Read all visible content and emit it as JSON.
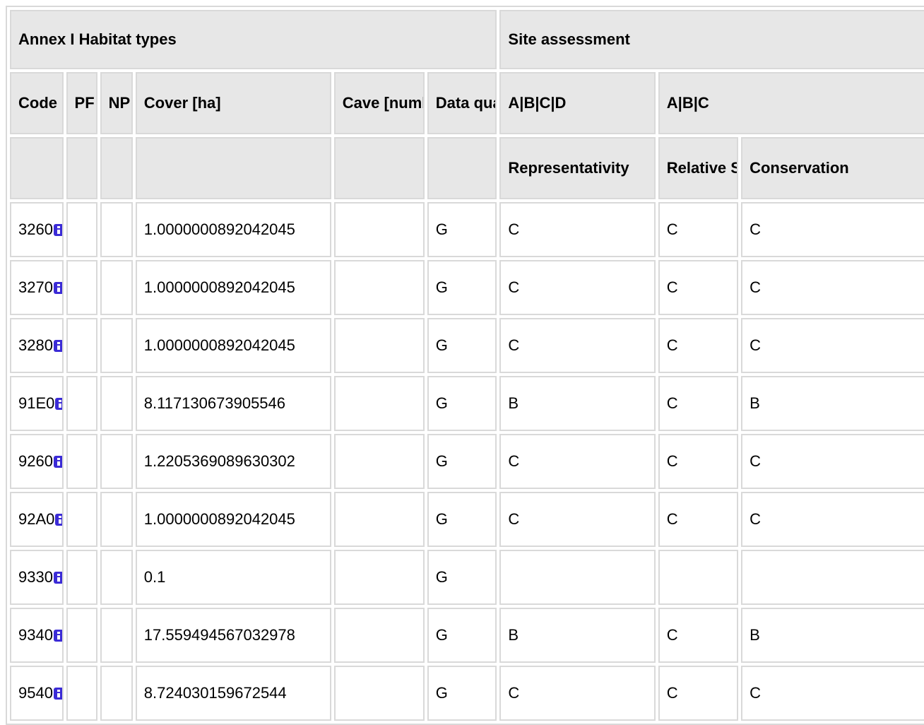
{
  "header": {
    "group_habitat": "Annex I Habitat types",
    "group_site": "Site assessment",
    "col_code": "Code",
    "col_pf": "PF",
    "col_np": "NP",
    "col_cover": "Cover [ha]",
    "col_cave": "Cave [number]",
    "col_quality": "Data quality",
    "col_abcd": "A|B|C|D",
    "col_abc": "A|B|C",
    "sub_representativity": "Representativity",
    "sub_relative_surface": "Relative Surface",
    "sub_conservation": "Conservation"
  },
  "rows": [
    {
      "code": "3260",
      "pf": "",
      "np": "",
      "cover": "1.0000000892042045",
      "cave": "",
      "quality": "G",
      "rep": "C",
      "rel": "C",
      "cons": "C"
    },
    {
      "code": "3270",
      "pf": "",
      "np": "",
      "cover": "1.0000000892042045",
      "cave": "",
      "quality": "G",
      "rep": "C",
      "rel": "C",
      "cons": "C"
    },
    {
      "code": "3280",
      "pf": "",
      "np": "",
      "cover": "1.0000000892042045",
      "cave": "",
      "quality": "G",
      "rep": "C",
      "rel": "C",
      "cons": "C"
    },
    {
      "code": "91E0",
      "pf": "",
      "np": "",
      "cover": "8.117130673905546",
      "cave": "",
      "quality": "G",
      "rep": "B",
      "rel": "C",
      "cons": "B"
    },
    {
      "code": "9260",
      "pf": "",
      "np": "",
      "cover": "1.2205369089630302",
      "cave": "",
      "quality": "G",
      "rep": "C",
      "rel": "C",
      "cons": "C"
    },
    {
      "code": "92A0",
      "pf": "",
      "np": "",
      "cover": "1.0000000892042045",
      "cave": "",
      "quality": "G",
      "rep": "C",
      "rel": "C",
      "cons": "C"
    },
    {
      "code": "9330",
      "pf": "",
      "np": "",
      "cover": "0.1",
      "cave": "",
      "quality": "G",
      "rep": "",
      "rel": "",
      "cons": ""
    },
    {
      "code": "9340",
      "pf": "",
      "np": "",
      "cover": "17.559494567032978",
      "cave": "",
      "quality": "G",
      "rep": "B",
      "rel": "C",
      "cons": "B"
    },
    {
      "code": "9540",
      "pf": "",
      "np": "",
      "cover": "8.724030159672544",
      "cave": "",
      "quality": "G",
      "rep": "C",
      "rel": "C",
      "cons": "C"
    }
  ],
  "icons": {
    "info": "info-icon"
  },
  "colors": {
    "header_bg": "#e7e7e7",
    "border": "#d9d9d9",
    "info_icon": "#3b2bd6"
  }
}
